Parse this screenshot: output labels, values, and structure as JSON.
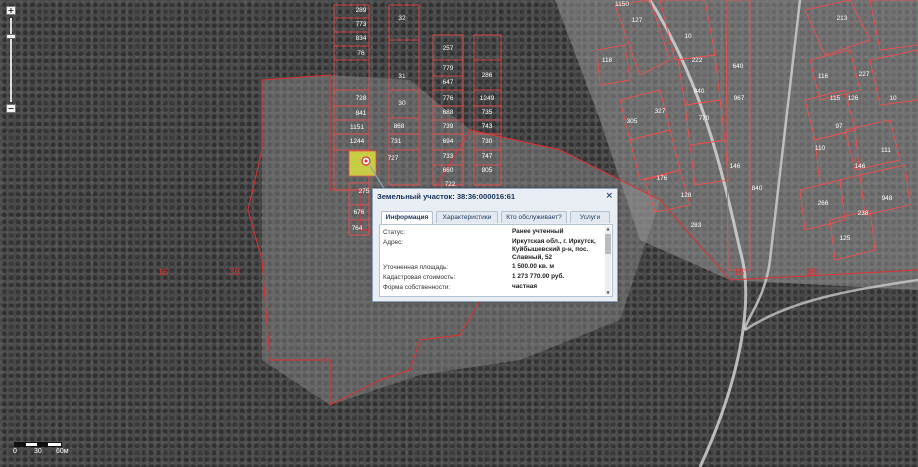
{
  "popup": {
    "title": "Земельный участок: 38:36:000016:61",
    "close": "×",
    "tabs": [
      "Информация",
      "Характеристики",
      "Кто обслуживает?",
      "Услуги"
    ],
    "rows": [
      {
        "label": "Статус:",
        "value": "Ранее учтенный"
      },
      {
        "label": "Адрес:",
        "value": "Иркутская обл., г. Иркутск, Куйбышевский р-н, пос. Славный, 52"
      },
      {
        "label": "Уточненная площадь:",
        "value": "1 500.00 кв. м"
      },
      {
        "label": "Кадастровая стоимость:",
        "value": "1 273 770.00 руб."
      },
      {
        "label": "Форма собственности:",
        "value": "частная"
      }
    ]
  },
  "zoom": {
    "plus": "+",
    "minus": "−"
  },
  "scale": {
    "zero": "0",
    "mid": "30",
    "end": "60м"
  },
  "map_labels": {
    "zone_left": [
      "16",
      "36"
    ],
    "zone_right": [
      "16",
      "36"
    ],
    "parcels_mid": [
      "289",
      "32",
      "773",
      "834",
      "76",
      "31",
      "728",
      "30",
      "841",
      "868",
      "1151",
      "731",
      "1244",
      "727",
      "275",
      "676",
      "764",
      "257",
      "779",
      "647",
      "286",
      "776",
      "688",
      "1249",
      "739",
      "735",
      "694",
      "743",
      "733",
      "730",
      "747",
      "660",
      "805",
      "722"
    ],
    "parcels_right": [
      "1150",
      "127",
      "10",
      "118",
      "222",
      "640",
      "840",
      "305",
      "770",
      "327",
      "967",
      "176",
      "128",
      "283",
      "146",
      "213",
      "227",
      "116",
      "115",
      "126",
      "97",
      "110",
      "111",
      "146",
      "948",
      "266",
      "238",
      "840",
      "125",
      "10"
    ]
  },
  "colors": {
    "parcel_line": "#ff4a4a",
    "parcel_text": "#ffffff",
    "highlight": "#d8e040",
    "popup_title": "#15325a"
  }
}
